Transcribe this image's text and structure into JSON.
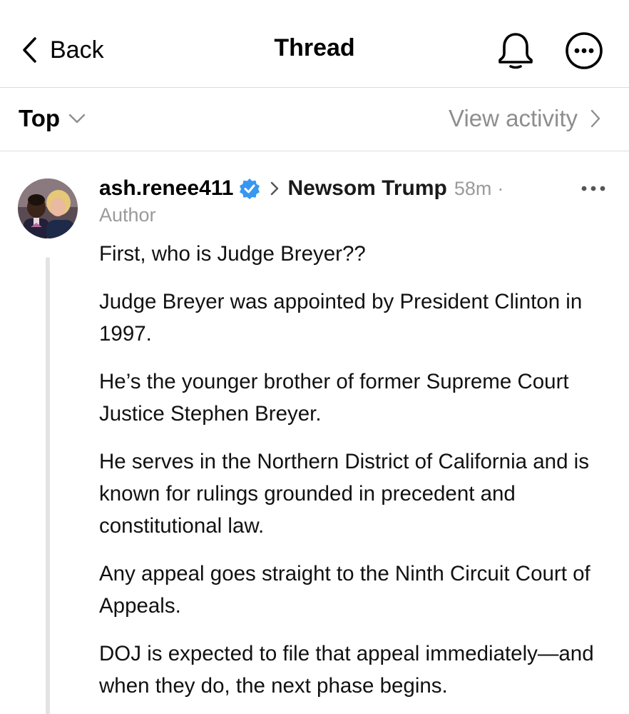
{
  "navbar": {
    "back_label": "Back",
    "title": "Thread",
    "bell_icon": "bell-icon",
    "more_icon": "more-circle-icon"
  },
  "sortbar": {
    "sort_label": "Top",
    "view_activity_label": "View activity"
  },
  "post": {
    "username": "ash.renee411",
    "verified": true,
    "topic": "Newsom Trump",
    "timestamp": "58m",
    "separator": "·",
    "author_tag": "Author",
    "paragraphs": [
      "First, who is Judge Breyer??",
      "Judge Breyer was appointed by President Clinton in 1997.",
      "He’s the younger brother of former Supreme Court Justice Stephen Breyer.",
      "He serves in the Northern District of California and is known for rulings grounded in precedent and constitutional law.",
      "Any appeal goes straight to the Ninth Circuit Court of Appeals.",
      "DOJ is expected to file that appeal immediately—and when they do, the next phase begins."
    ]
  },
  "colors": {
    "text": "#000000",
    "secondary_text": "#8e8e8e",
    "verified_badge": "#3897f0",
    "divider": "#dcdcdc",
    "thread_line": "#e3e3e3"
  }
}
